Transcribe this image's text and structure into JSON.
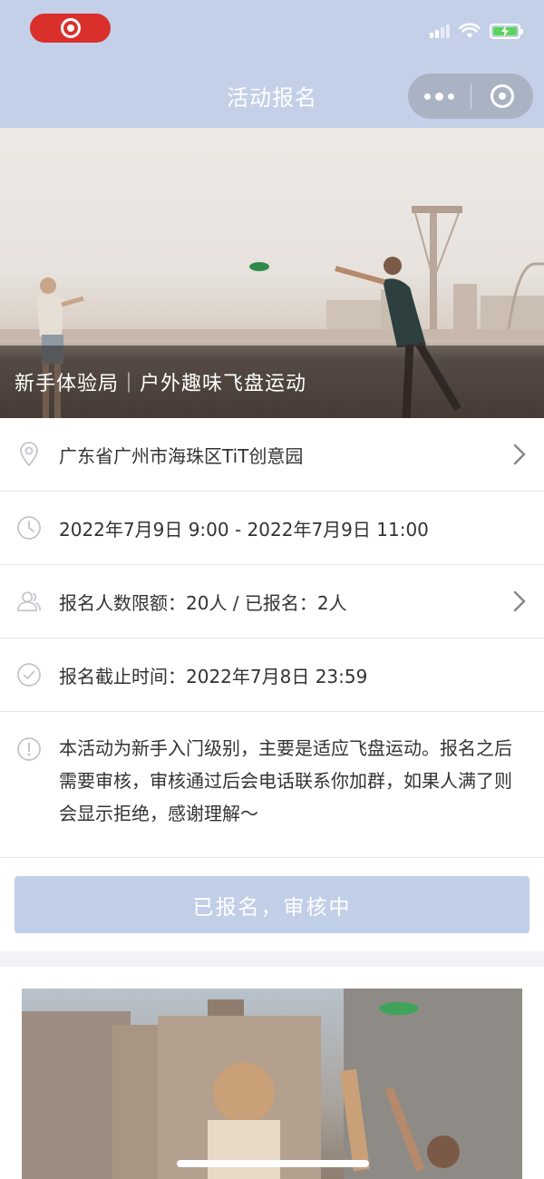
{
  "nav": {
    "title": "活动报名"
  },
  "banner": {
    "caption": "新手体验局｜户外趣味飞盘运动"
  },
  "info": {
    "location": "广东省广州市海珠区TiT创意园",
    "time": "2022年7月9日 9:00 - 2022年7月9日 11:00",
    "quota": "报名人数限额：20人 / 已报名：2人",
    "deadline": "报名截止时间：2022年7月8日 23:59",
    "description": "本活动为新手入门级别，主要是适应飞盘运动。报名之后需要审核，审核通过后会电话联系你加群，如果人满了则会显示拒绝，感谢理解～"
  },
  "button": {
    "label": "已报名，审核中"
  },
  "icons": {
    "record": "record-icon",
    "signal": "signal-icon",
    "wifi": "wifi-icon",
    "battery": "battery-charging-icon",
    "more": "more-icon",
    "close": "close-miniprogram-icon",
    "location": "location-pin-icon",
    "clock": "clock-icon",
    "people": "people-icon",
    "check": "check-circle-icon",
    "info": "info-circle-icon",
    "chevron": "chevron-right-icon"
  },
  "colors": {
    "header_bg": "#c3d0e8",
    "button_bg": "#c1cfe8",
    "record_red": "#d9302c",
    "battery_green": "#5ad55a"
  }
}
